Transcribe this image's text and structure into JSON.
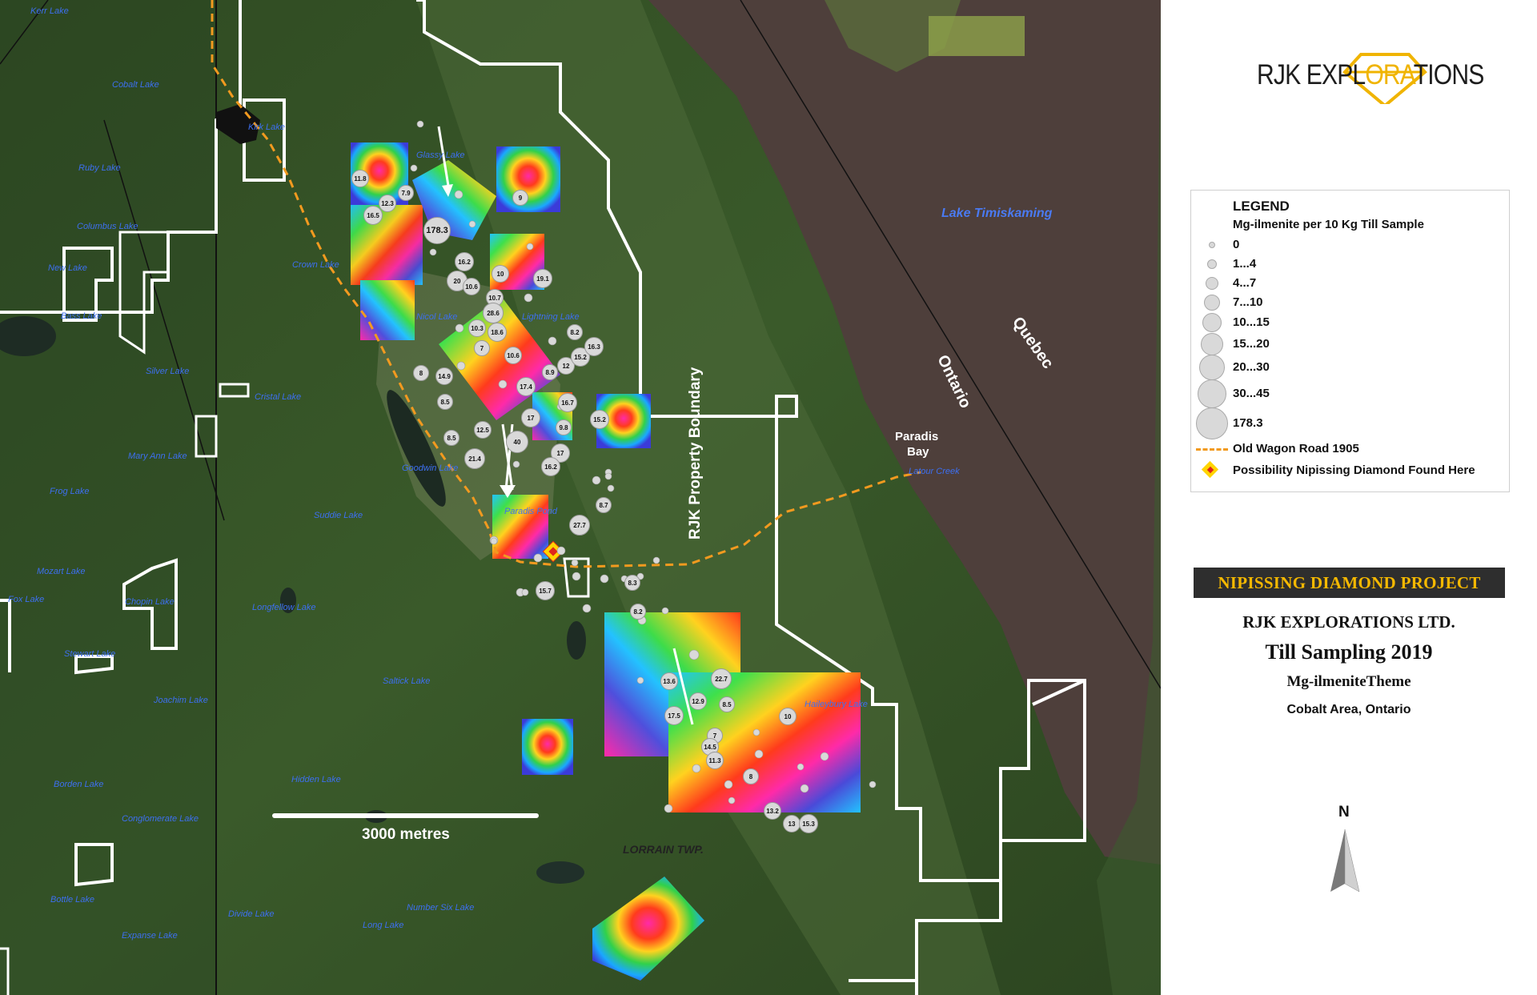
{
  "logo": {
    "part1": "RJK EXPL",
    "part2": "ORA",
    "part3": "TIONS"
  },
  "legend": {
    "title": "LEGEND",
    "subtitle": "Mg-ilmenite  per 10 Kg Till Sample",
    "classes": [
      "0",
      "1...4",
      "4...7",
      "7...10",
      "10...15",
      "15...20",
      "20...30",
      "30...45",
      "178.3"
    ],
    "road_label": "Old Wagon Road 1905",
    "diamond_label": "Possibility Nipissing Diamond Found Here",
    "colors": {
      "road": "#f29a1f",
      "diamond_fill": "#ffd400",
      "diamond_center": "#e0261b",
      "circle_fill": "#d9d9d9"
    }
  },
  "project": {
    "banner": "NIPISSING DIAMOND PROJECT",
    "company": "RJK EXPLORATIONS LTD.",
    "survey": "Till Sampling 2019",
    "theme": "Mg-ilmeniteTheme",
    "area": "Cobalt Area, Ontario"
  },
  "north_label": "N",
  "map": {
    "scale_label": "3000 metres",
    "boundary_label": "RJK Property Boundary",
    "township_label": "LORRAIN TWP.",
    "province_labels": {
      "ontario": "Ontario",
      "quebec": "Quebec"
    },
    "paradis_bay": [
      "Paradis",
      "Bay"
    ],
    "big_lake": "Lake Timiskaming",
    "lakes": [
      "Kerr Lake",
      "Kirk Lake",
      "Cobalt Lake",
      "Glassy Lake",
      "Crown Lake",
      "Nicol Lake",
      "Lightning Lake",
      "Cristal Lake",
      "Goodwin Lake",
      "Paradis Pond",
      "Suddie Lake",
      "Longfellow Lake",
      "Saltick Lake",
      "Hidden Lake",
      "Conglomerate Lake",
      "Long Lake",
      "Number Six Lake",
      "Divide Lake",
      "Expanse Lake",
      "Bottle Lake",
      "Borden Lake",
      "Joachim Lake",
      "Stewart Lake",
      "Chopin Lake",
      "Mozart Lake",
      "Frog Lake",
      "Mary Ann Lake",
      "Silver Lake",
      "Bass Lake",
      "Columbus Lake",
      "New Lake",
      "Ruby Lake",
      "Fox Lake",
      "Latour Creek",
      "Haileybury Lake"
    ],
    "sample_labels": [
      "11.8",
      "12.3",
      "7.9",
      "16.5",
      "178.3",
      "9",
      "16.2",
      "10",
      "19.1",
      "20",
      "10.6",
      "10.7",
      "28.6",
      "10.3",
      "18.6",
      "7",
      "10.6",
      "17.4",
      "8.9",
      "12",
      "15.2",
      "16.3",
      "8.2",
      "8",
      "14.9",
      "8.5",
      "16.7",
      "15.2",
      "17",
      "12.5",
      "9.8",
      "40",
      "8.5",
      "21.4",
      "17",
      "16.2",
      "8.7",
      "27.7",
      "15.7",
      "8.3",
      "8.2",
      "13.6",
      "22.7",
      "12.9",
      "8.5",
      "17.5",
      "7",
      "10",
      "14.5",
      "11.3",
      "8",
      "13.2",
      "13",
      "15.3"
    ]
  }
}
